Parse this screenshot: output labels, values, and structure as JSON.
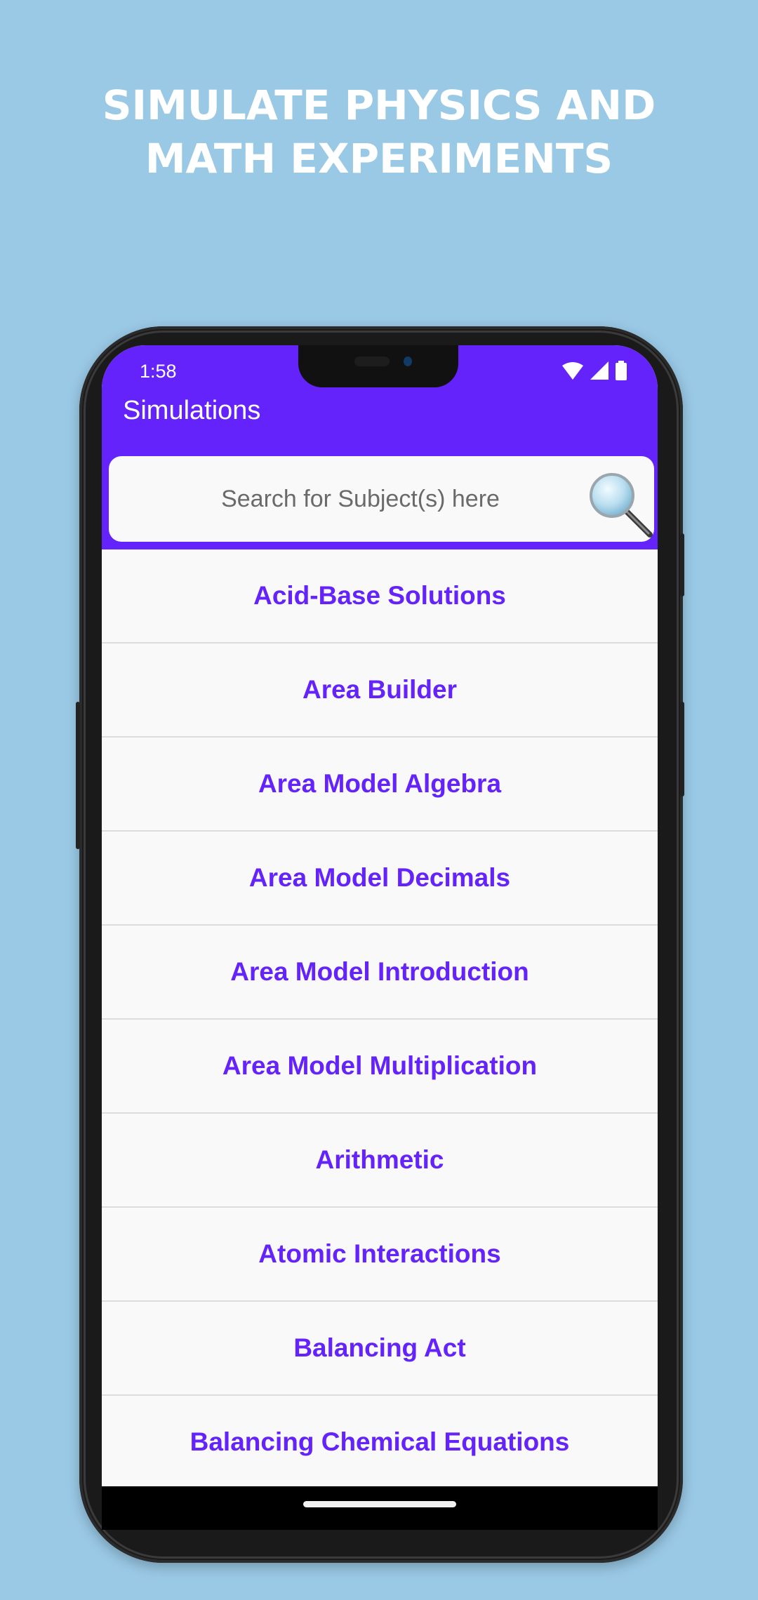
{
  "promo": {
    "headline_line1": "SIMULATE PHYSICS AND",
    "headline_line2": "MATH EXPERIMENTS"
  },
  "status_bar": {
    "time": "1:58",
    "icons": [
      "wifi-icon",
      "signal-icon",
      "battery-icon"
    ]
  },
  "app_bar": {
    "title": "Simulations",
    "color": "#6523fb"
  },
  "search": {
    "placeholder": "Search for Subject(s) here",
    "value": "",
    "icon": "magnifier-icon"
  },
  "list": {
    "text_color": "#6523fb",
    "items": [
      {
        "label": "Acid-Base Solutions"
      },
      {
        "label": "Area Builder"
      },
      {
        "label": "Area Model Algebra"
      },
      {
        "label": "Area Model Decimals"
      },
      {
        "label": "Area Model Introduction"
      },
      {
        "label": "Area Model Multiplication"
      },
      {
        "label": "Arithmetic"
      },
      {
        "label": "Atomic Interactions"
      },
      {
        "label": "Balancing Act"
      },
      {
        "label": "Balancing Chemical Equations"
      }
    ]
  }
}
